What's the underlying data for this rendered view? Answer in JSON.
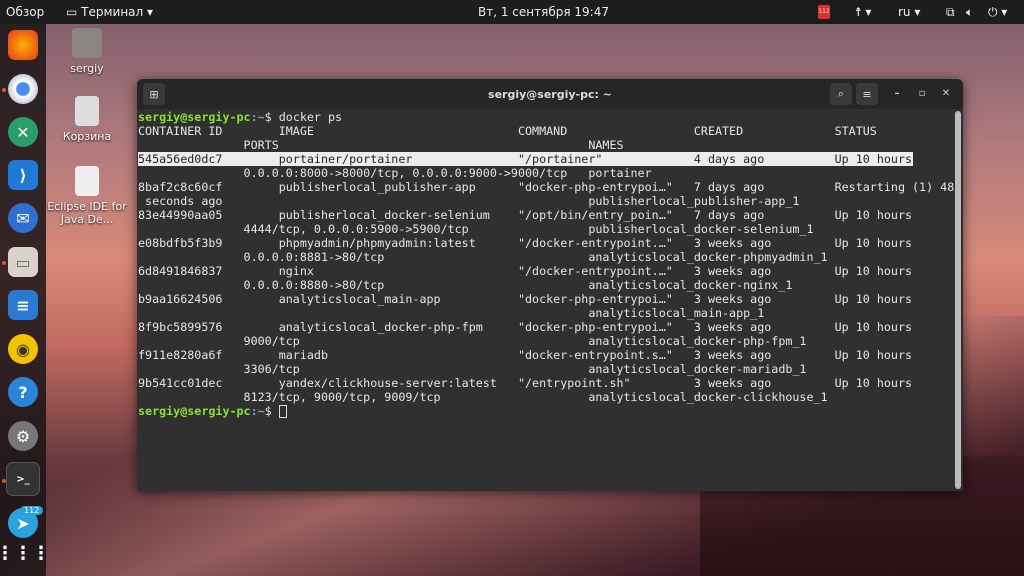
{
  "topbar": {
    "overview": "Обзор",
    "app": "Терминал",
    "datetime": "Вт, 1 сентября  19:47",
    "lang": "ru",
    "badge": "112"
  },
  "desktop": [
    {
      "label": "sergiy"
    },
    {
      "label": "Корзина"
    },
    {
      "label": "Eclipse IDE for Java De..."
    }
  ],
  "dock": {
    "telegram_badge": "112"
  },
  "window": {
    "title": "sergiy@sergiy-pc: ~"
  },
  "terminal": {
    "prompt_user": "sergiy@sergiy-pc",
    "prompt_path": ":~",
    "prompt_sym": "$ ",
    "command": "docker ps",
    "headers": {
      "id": "CONTAINER ID",
      "image": "IMAGE",
      "command": "COMMAND",
      "created": "CREATED",
      "status": "STATUS",
      "ports": "PORTS",
      "names": "NAMES"
    },
    "rows": [
      {
        "id": "545a56ed0dc7",
        "image": "portainer/portainer",
        "command": "\"/portainer\"",
        "created": "4 days ago",
        "status": "Up 10 hours",
        "ports": "0.0.0.0:8000->8000/tcp, 0.0.0.0:9000->9000/tcp",
        "names": "portainer"
      },
      {
        "id": "8baf2c8c60cf",
        "image": "publisherlocal_publisher-app",
        "command": "\"docker-php-entrypoi…\"",
        "created": "7 days ago",
        "status": "Restarting (1) 48",
        "ports": " seconds ago",
        "names": "publisherlocal_publisher-app_1"
      },
      {
        "id": "83e44990aa05",
        "image": "publisherlocal_docker-selenium",
        "command": "\"/opt/bin/entry_poin…\"",
        "created": "7 days ago",
        "status": "Up 10 hours",
        "ports": "4444/tcp, 0.0.0.0:5900->5900/tcp",
        "names": "publisherlocal_docker-selenium_1"
      },
      {
        "id": "e08bdfb5f3b9",
        "image": "phpmyadmin/phpmyadmin:latest",
        "command": "\"/docker-entrypoint.…\"",
        "created": "3 weeks ago",
        "status": "Up 10 hours",
        "ports": "0.0.0.0:8881->80/tcp",
        "names": "analyticslocal_docker-phpmyadmin_1"
      },
      {
        "id": "6d8491846837",
        "image": "nginx",
        "command": "\"/docker-entrypoint.…\"",
        "created": "3 weeks ago",
        "status": "Up 10 hours",
        "ports": "0.0.0.0:8880->80/tcp",
        "names": "analyticslocal_docker-nginx_1"
      },
      {
        "id": "b9aa16624506",
        "image": "analyticslocal_main-app",
        "command": "\"docker-php-entrypoi…\"",
        "created": "3 weeks ago",
        "status": "Up 10 hours",
        "ports": "",
        "names": "analyticslocal_main-app_1"
      },
      {
        "id": "8f9bc5899576",
        "image": "analyticslocal_docker-php-fpm",
        "command": "\"docker-php-entrypoi…\"",
        "created": "3 weeks ago",
        "status": "Up 10 hours",
        "ports": "9000/tcp",
        "names": "analyticslocal_docker-php-fpm_1"
      },
      {
        "id": "f911e8280a6f",
        "image": "mariadb",
        "command": "\"docker-entrypoint.s…\"",
        "created": "3 weeks ago",
        "status": "Up 10 hours",
        "ports": "3306/tcp",
        "names": "analyticslocal_docker-mariadb_1"
      },
      {
        "id": "9b541cc01dec",
        "image": "yandex/clickhouse-server:latest",
        "command": "\"/entrypoint.sh\"",
        "created": "3 weeks ago",
        "status": "Up 10 hours",
        "ports": "8123/tcp, 9000/tcp, 9009/tcp",
        "names": "analyticslocal_docker-clickhouse_1"
      }
    ]
  }
}
